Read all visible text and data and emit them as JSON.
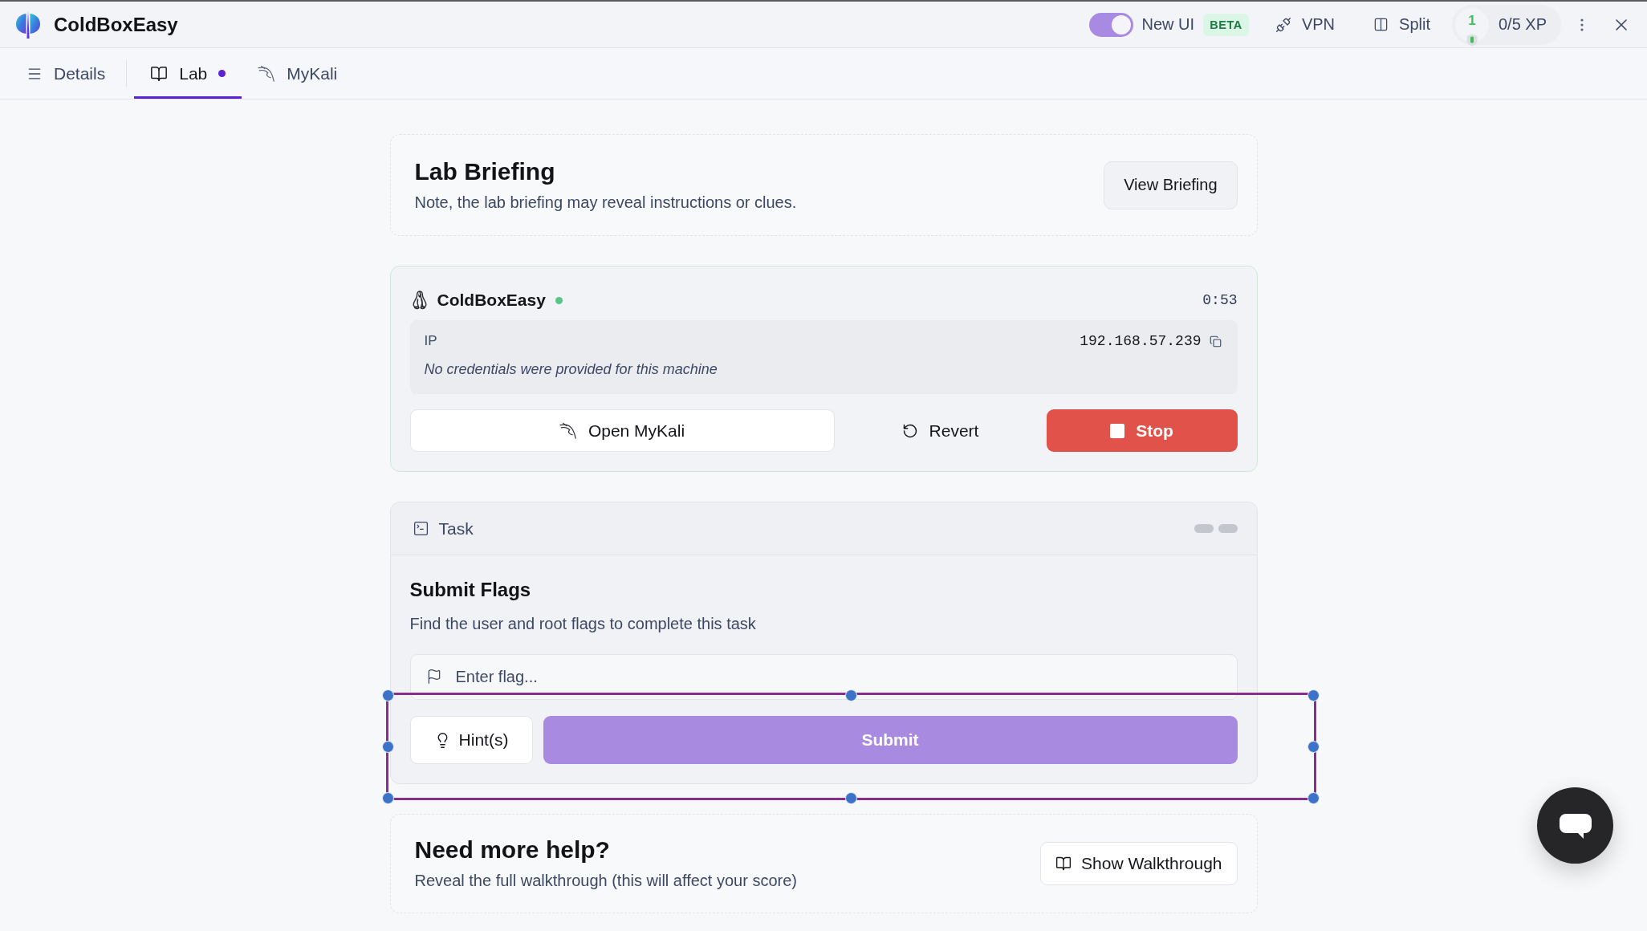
{
  "header": {
    "title": "ColdBoxEasy",
    "new_ui": {
      "label": "New UI",
      "on": true
    },
    "beta_badge": "BETA",
    "actions": [
      {
        "label": "VPN"
      },
      {
        "label": "Split"
      }
    ],
    "xp": {
      "level": "1",
      "progress": "0/5 XP"
    }
  },
  "tabs": [
    {
      "label": "Details",
      "selected": false,
      "unread": false
    },
    {
      "label": "Lab",
      "selected": true,
      "unread": true
    },
    {
      "label": "MyKali",
      "selected": false,
      "unread": false
    }
  ],
  "briefing": {
    "title": "Lab Briefing",
    "note": "Note, the lab briefing may reveal instructions or clues.",
    "button": "View Briefing"
  },
  "machine": {
    "name": "ColdBoxEasy",
    "online": true,
    "timer": "0:53",
    "ip_label": "IP",
    "ip": "192.168.57.239",
    "credentials_note": "No credentials were provided for this machine",
    "buttons": [
      {
        "label": "Open MyKali",
        "kind": "outline"
      },
      {
        "label": "Revert",
        "kind": "ghost"
      },
      {
        "label": "Stop",
        "kind": "danger"
      }
    ]
  },
  "task": {
    "title": "Task",
    "progress_pills": [
      {
        "filled": false
      },
      {
        "filled": false
      }
    ],
    "heading": "Submit Flags",
    "description": "Find the user and root flags to complete this task",
    "flag_field": {
      "placeholder": "Enter flag..."
    },
    "hint_button": "Hint(s)",
    "submit_button": {
      "label": "Submit",
      "disabled": true
    },
    "actions_selected": true
  },
  "help": {
    "title": "Need more help?",
    "note": "Reveal the full walkthrough (this will affect your score)",
    "button": "Show Walkthrough"
  }
}
